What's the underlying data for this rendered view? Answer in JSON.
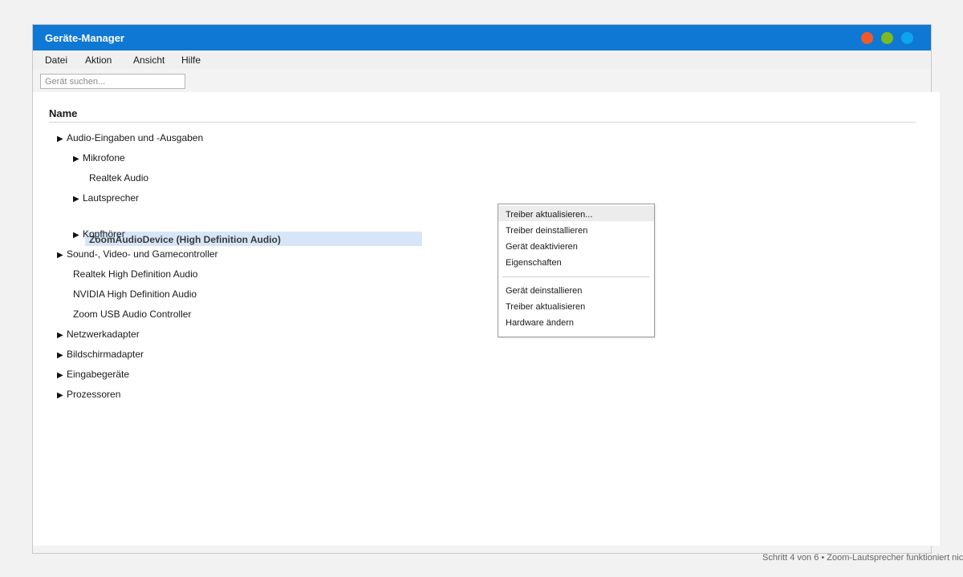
{
  "window": {
    "title": "Geräte-Manager",
    "accent": "#0f78d4",
    "dots": [
      "#f05a28",
      "#7cba1f",
      "#0ea4ee"
    ]
  },
  "menu": {
    "datei": "Datei",
    "aktion": "Aktion",
    "ansicht": "Ansicht",
    "hilfe": "Hilfe"
  },
  "search": {
    "placeholder": "Gerät suchen...",
    "value": ""
  },
  "tree": {
    "column_header": "Name",
    "expander_glyph": "▶",
    "audio": "Audio-Eingaben und -Ausgaben",
    "mikrofone": "Mikrofone",
    "realtek_audio": "Realtek Audio",
    "lautsprecher": "Lautsprecher",
    "zoom_device": "ZoomAudioDevice (High Definition Audio)",
    "kopfhoerer": "Kopfhörer",
    "sound": "Sound-, Video- und Gamecontroller",
    "realtek_hd": "Realtek High Definition Audio",
    "nvidia_hd": "NVIDIA High Definition Audio",
    "zoom_usb": "Zoom USB Audio Controller",
    "netzwerk": "Netzwerkadapter",
    "bildschirm": "Bildschirmadapter",
    "eingabe": "Eingabegeräte",
    "prozessoren": "Prozessoren"
  },
  "context_menu": {
    "treiber_aktualisieren_dots": "Treiber aktualisieren...",
    "treiber_deinstallieren": "Treiber deinstallieren",
    "geraet_deaktivieren": "Gerät deaktivieren",
    "eigenschaften": "Eigenschaften",
    "geraet_deinstallieren": "Gerät deinstallieren",
    "treiber_aktualisieren": "Treiber aktualisieren",
    "hardware_aendern": "Hardware ändern"
  },
  "status": {
    "text": "Schritt 4 von 6 • Zoom-Lautsprecher funktioniert nic"
  }
}
